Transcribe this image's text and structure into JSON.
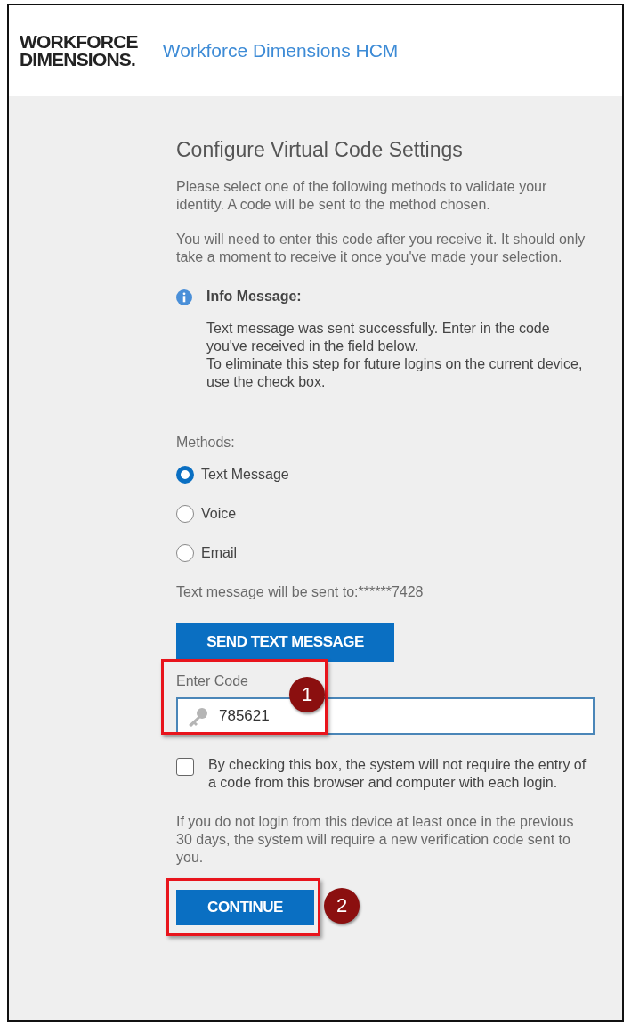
{
  "header": {
    "logo_lines": [
      "WORKFORCE",
      "DIMENSIONS."
    ],
    "app_title": "Workforce Dimensions HCM"
  },
  "page_title": "Configure Virtual Code Settings",
  "intro": [
    "Please select one of the following methods to validate your identity. A code will be sent to the method chosen.",
    "You will need to enter this code after you receive it. It should only take a moment to receive it once you've made your selection."
  ],
  "info": {
    "title": "Info Message:",
    "lines": [
      "Text message was sent successfully. Enter in the code you've received in the field below.",
      "To eliminate this step for future logins on the current device, use the check box."
    ]
  },
  "methods": {
    "label": "Methods:",
    "options": [
      {
        "label": "Text Message",
        "selected": true
      },
      {
        "label": "Voice",
        "selected": false
      },
      {
        "label": "Email",
        "selected": false
      }
    ]
  },
  "destination": "Text message will be sent to:******7428",
  "send_button": "SEND TEXT MESSAGE",
  "code_field": {
    "label": "Enter Code",
    "value": "785621"
  },
  "remember": {
    "checked": false,
    "text": "By checking this box, the system will not require the entry of a code from this browser and computer with each login."
  },
  "notice": "If you do not login from this device at least once in the previous 30 days, the system will require a new verification code sent to you.",
  "continue_button": "CONTINUE",
  "callouts": [
    "1",
    "2"
  ]
}
